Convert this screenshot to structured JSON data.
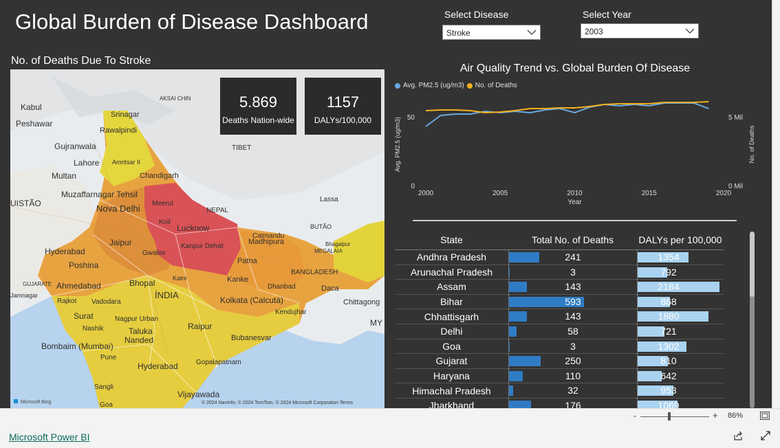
{
  "header": {
    "title": "Global Burden of Disease Dashboard"
  },
  "filters": {
    "disease": {
      "label": "Select Disease",
      "value": "Stroke"
    },
    "year": {
      "label": "Select Year",
      "value": "2003"
    }
  },
  "map": {
    "title": "No. of Deaths Due To Stroke",
    "labels": [
      "Kabul",
      "Peshawar",
      "Rawalpindi",
      "Gujranwala",
      "Lahore",
      "Multan",
      "Muzaffarnagar Tehsil",
      "Amritsar II",
      "Chandigarh",
      "Nova Delhi",
      "Meerut",
      "Jaipur",
      "Koil",
      "Lucknow",
      "Kanpur Dehat",
      "Catmandu",
      "NEPAL",
      "TIBET",
      "Lassa",
      "BUTÃO",
      "Madhipura",
      "Patna",
      "Kanke",
      "Bhopal",
      "Ahmedabad",
      "ÍNDIA",
      "Kolkata (Calcutá)",
      "Dhanbad",
      "BANGLADESH",
      "Daca",
      "Chittagong",
      "Rajkot",
      "Vadodara",
      "Surat",
      "Nashik",
      "Nagpur Urban",
      "Raipur",
      "Bombaim (Mumbai)",
      "Pune",
      "Nanded",
      "Bubanesvar",
      "Hyderabad",
      "Gopalapatnam",
      "Vijayawada",
      "Sangli",
      "Goa",
      "Jamnagar",
      "Poshina",
      "Hyderabad",
      "UISTÃO",
      "MY",
      "Srinagar",
      "AKSAI CHIN",
      "GUJARATE",
      "MEGALAIA",
      "Kendujhar",
      "Gwalior",
      "Katni",
      "Talukа",
      "Bhagalpur"
    ],
    "attribution": "Microsoft Bing",
    "copyright": "© 2024 NavInfo, © 2024 TomTom, © 2024 Microsoft Corporation  Terms"
  },
  "kpis": [
    {
      "value": "5.869",
      "label": "Deaths Nation-wide"
    },
    {
      "value": "1157",
      "label": "DALYs/100,000"
    }
  ],
  "colors": {
    "pm25": "#6aa8e0",
    "deaths": "#f2b01e",
    "bar_deaths": "#2f7cc4",
    "bar_dalys": "#a9d2f0"
  },
  "chart_data": {
    "type": "line",
    "title": "Air Quality Trend vs. Global Burden Of Disease",
    "xlabel": "Year",
    "ylabel": "Avg. PM2.5 (ug/m3)",
    "y2label": "No. of Deaths",
    "x": [
      2000,
      2001,
      2002,
      2003,
      2004,
      2005,
      2006,
      2007,
      2008,
      2009,
      2010,
      2011,
      2012,
      2013,
      2014,
      2015,
      2016,
      2017,
      2018,
      2019
    ],
    "xticks": [
      "2000",
      "2005",
      "2010",
      "2015",
      "2020"
    ],
    "xlim": [
      2000,
      2020
    ],
    "yticks": [
      "0",
      "50"
    ],
    "ylim": [
      0,
      60
    ],
    "y2ticks": [
      "0 Mil",
      "5 Mil"
    ],
    "y2lim": [
      0,
      6
    ],
    "series": [
      {
        "name": "Avg. PM2.5 (ug/m3)",
        "axis": "left",
        "values": [
          43,
          51,
          52,
          52,
          54,
          53,
          54,
          53,
          55,
          56,
          53,
          57,
          59,
          58,
          59,
          58,
          60,
          60,
          60,
          56
        ]
      },
      {
        "name": "No. of Deaths",
        "axis": "right",
        "values": [
          5.45,
          5.5,
          5.5,
          5.45,
          5.3,
          5.35,
          5.45,
          5.6,
          5.6,
          5.65,
          5.65,
          5.75,
          5.9,
          5.95,
          5.95,
          5.95,
          6.05,
          6.05,
          6.05,
          6.1
        ]
      }
    ]
  },
  "table": {
    "headers": [
      "State",
      "Total No. of Deaths",
      "DALYs per 100,000"
    ],
    "max_deaths": 600,
    "max_dalys": 2200,
    "rows": [
      {
        "state": "Andhra Pradesh",
        "deaths": "241",
        "dalys": "1354"
      },
      {
        "state": "Arunachal Pradesh",
        "deaths": "3",
        "dalys": "792"
      },
      {
        "state": "Assam",
        "deaths": "143",
        "dalys": "2184"
      },
      {
        "state": "Bihar",
        "deaths": "593",
        "dalys": "868"
      },
      {
        "state": "Chhattisgarh",
        "deaths": "143",
        "dalys": "1880"
      },
      {
        "state": "Delhi",
        "deaths": "58",
        "dalys": "721"
      },
      {
        "state": "Goa",
        "deaths": "3",
        "dalys": "1302"
      },
      {
        "state": "Gujarat",
        "deaths": "250",
        "dalys": "810"
      },
      {
        "state": "Haryana",
        "deaths": "110",
        "dalys": "642"
      },
      {
        "state": "Himachal Pradesh",
        "deaths": "32",
        "dalys": "953"
      },
      {
        "state": "Jharkhand",
        "deaths": "176",
        "dalys": "1069"
      }
    ]
  },
  "zoom": {
    "minus": "-",
    "plus": "+",
    "level": "86%"
  },
  "footer": {
    "brand": "Microsoft Power BI"
  }
}
